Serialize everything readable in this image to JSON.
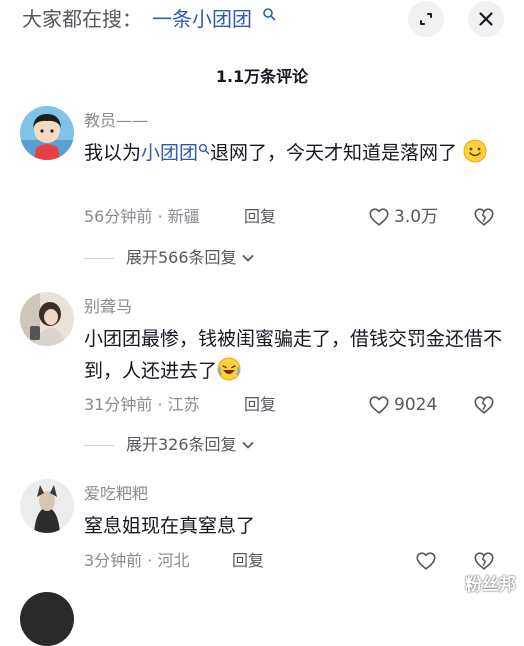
{
  "header": {
    "search_prefix": "大家都在搜：",
    "search_term": "一条小团团",
    "comment_count": "1.1万条评论"
  },
  "comments": [
    {
      "username": "教员——",
      "text_before": "我以为",
      "link": "小团团",
      "text_after": "退网了，今天才知道是落网了",
      "time": "56分钟前",
      "location": "新疆",
      "reply_label": "回复",
      "likes": "3.0万",
      "expand": "展开566条回复"
    },
    {
      "username": "别聋马",
      "text": "小团团最惨，钱被闺蜜骗走了，借钱交罚金还借不到，人还进去了",
      "time": "31分钟前",
      "location": "江苏",
      "reply_label": "回复",
      "likes": "9024",
      "expand": "展开326条回复"
    },
    {
      "username": "爱吃粑粑",
      "text": "窒息姐现在真窒息了",
      "time": "3分钟前",
      "location": "河北",
      "reply_label": "回复"
    }
  ],
  "meta_separator": " · ",
  "watermark": "粉丝邦",
  "colors": {
    "link": "#2f5bb7",
    "text": "#161823",
    "secondary": "#8a8b91",
    "button_bg": "#f1f1f2"
  },
  "icons": [
    "search-icon",
    "collapse-icon",
    "close-icon",
    "heart-icon",
    "dislike-icon",
    "chevron-down-icon",
    "smile-emoji",
    "laugh-emoji"
  ]
}
